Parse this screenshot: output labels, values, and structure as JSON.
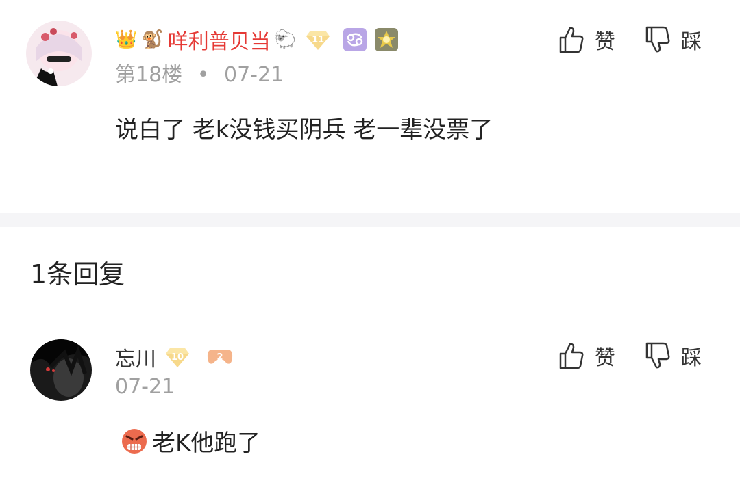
{
  "comment": {
    "username": "咩利普贝当",
    "floor_label": "第18楼",
    "separator": "•",
    "date": "07-21",
    "like_label": "赞",
    "dislike_label": "踩",
    "text": "说白了 老k没钱买阴兵 老一辈没票了",
    "level_badge": "11",
    "icons": [
      "crown-icon",
      "monkey-icon",
      "sheep-icon",
      "diamond-level-icon",
      "cancer-zodiac-icon",
      "medal-badge-icon"
    ]
  },
  "replies_header": "1条回复",
  "reply": {
    "username": "忘川",
    "date": "07-21",
    "like_label": "赞",
    "dislike_label": "踩",
    "text": "老K他跑了",
    "level_badge": "10",
    "second_badge": "2",
    "emoji": "angry-face-emoji"
  },
  "colors": {
    "username_vip": "#e53935",
    "meta": "#a0a0a0",
    "divider": "#f5f5f7"
  }
}
